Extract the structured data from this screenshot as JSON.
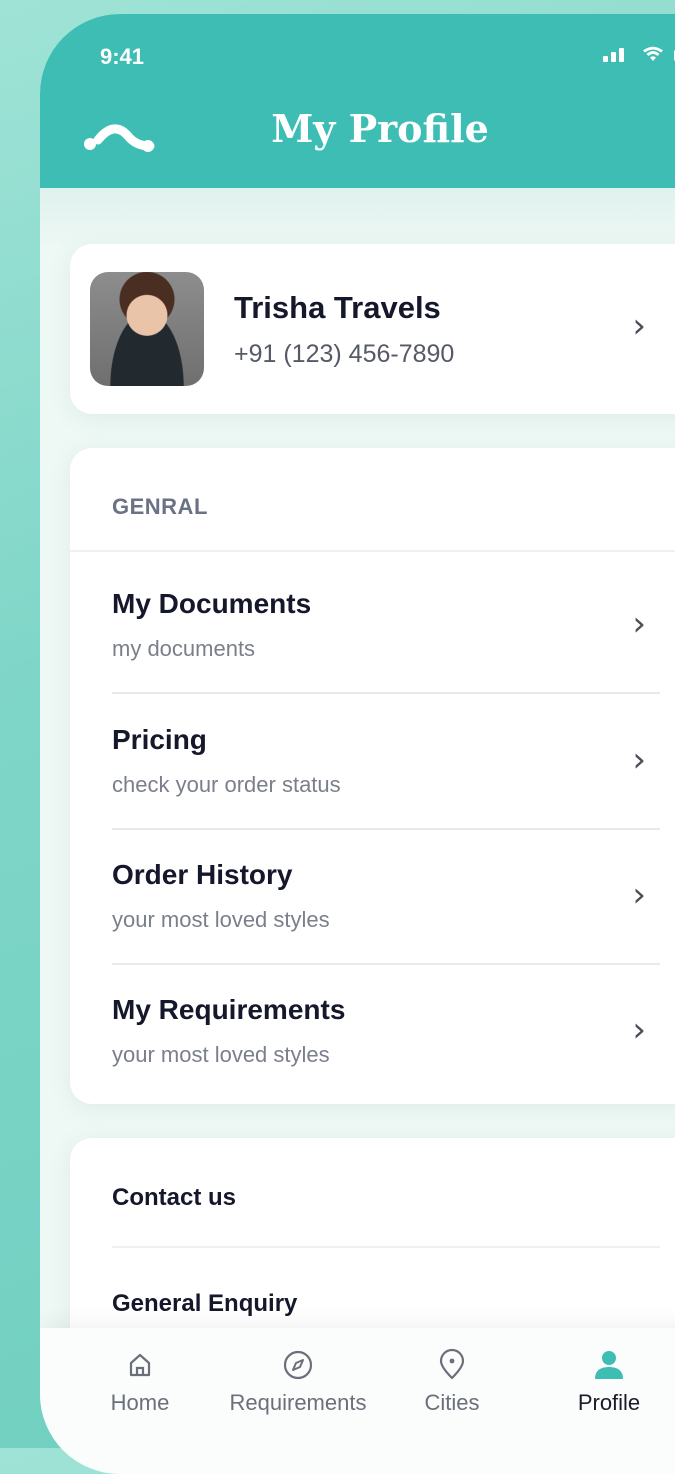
{
  "status_bar": {
    "time": "9:41"
  },
  "header": {
    "title": "My Profile"
  },
  "profile": {
    "name": "Trisha Travels",
    "phone": "+91 (123) 456-7890"
  },
  "general": {
    "section_label": "GENRAL",
    "items": [
      {
        "title": "My Documents",
        "subtitle": "my documents"
      },
      {
        "title": "Pricing",
        "subtitle": "check your order status"
      },
      {
        "title": "Order History",
        "subtitle": "your most loved styles"
      },
      {
        "title": "My Requirements",
        "subtitle": "your most loved styles"
      }
    ]
  },
  "contact": {
    "items": [
      {
        "title": "Contact us"
      },
      {
        "title": "General Enquiry"
      }
    ]
  },
  "tabbar": {
    "tabs": [
      {
        "label": "Home",
        "icon": "home-icon"
      },
      {
        "label": "Requirements",
        "icon": "compass-icon"
      },
      {
        "label": "Cities",
        "icon": "location-pin-icon"
      },
      {
        "label": "Profile",
        "icon": "user-icon",
        "active": true
      }
    ]
  },
  "colors": {
    "brand": "#3dbdb3",
    "text_dark": "#15172a",
    "text_muted": "#7a7f8a"
  }
}
